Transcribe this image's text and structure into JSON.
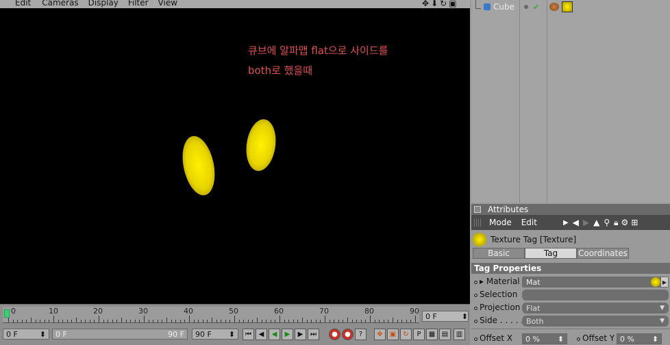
{
  "menu": [
    "Edit",
    "Cameras",
    "Display",
    "Filter",
    "View"
  ],
  "viewport": {
    "icons": [
      "move-icon",
      "arrow-down-icon",
      "rotate-icon",
      "maximize-icon"
    ],
    "note_line1": "큐브에 알파맵 flat으로 사이드를",
    "note_line2": "both로 했을때"
  },
  "timeline": {
    "ticks": [
      "0",
      "10",
      "20",
      "30",
      "40",
      "50",
      "60",
      "70",
      "80",
      "90"
    ],
    "frame_value": "0 F",
    "start_field": "0 F",
    "range_start": "0 F",
    "range_end": "90 F",
    "end_field": "90 F"
  },
  "objects": {
    "cube_label": "Cube"
  },
  "attributes": {
    "title": "Attributes",
    "mode": "Mode",
    "edit": "Edit",
    "tag_title": "Texture Tag [Texture]",
    "tabs": [
      "Basic",
      "Tag",
      "Coordinates"
    ],
    "active_tab": "Tag",
    "section": "Tag Properties",
    "material_label": "Material",
    "material_value": "Mat",
    "selection_label": "Selection",
    "selection_value": "",
    "projection_label": "Projection",
    "projection_value": "Flat",
    "side_label": "Side . . . . .",
    "side_value": "Both",
    "offset_x_label": "Offset X",
    "offset_x_value": "0 %",
    "offset_y_label": "Offset Y",
    "offset_y_value": "0 %"
  },
  "colors": {
    "accent_blob": "#f0e000",
    "note": "#e05050",
    "playhead": "#3fd06a"
  }
}
